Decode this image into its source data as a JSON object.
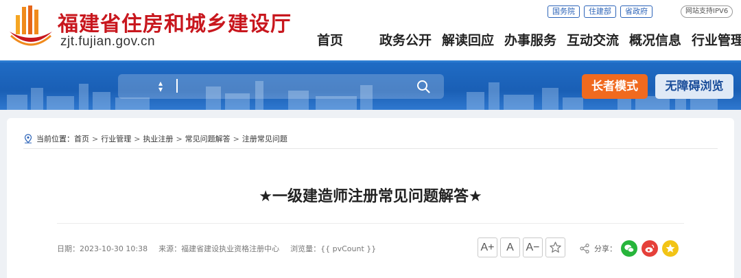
{
  "header": {
    "site_title": "福建省住房和城乡建设厅",
    "site_domain": "zjt.fujian.gov.cn",
    "top_links": [
      "国务院",
      "住建部",
      "省政府"
    ],
    "ipv6_badge": "网站支持IPV6",
    "nav": [
      "首页",
      "政务公开",
      "解读回应",
      "办事服务",
      "互动交流",
      "概况信息",
      "行业管理"
    ]
  },
  "banner": {
    "search_placeholder": "",
    "elder_mode_label": "长者模式",
    "accessible_label": "无障碍浏览"
  },
  "breadcrumb": {
    "prefix": "当前位置：",
    "items": [
      "首页",
      "行业管理",
      "执业注册",
      "常见问题解答",
      "注册常见问题"
    ],
    "separator": ">"
  },
  "article": {
    "title": "★一级建造师注册常见问题解答★",
    "date": "日期：2023-10-30 10:38",
    "source": "来源：福建省建设执业资格注册中心",
    "views": "浏览量：{{ pvCount }}"
  },
  "tools": {
    "font_larger": "A+",
    "font_normal": "A",
    "font_smaller": "A−"
  },
  "share": {
    "label": "分享："
  },
  "colors": {
    "title_red": "#c8171e",
    "banner_blue": "#1f6bc4",
    "elder_orange": "#f06a1f",
    "link_blue": "#2b63b8"
  }
}
